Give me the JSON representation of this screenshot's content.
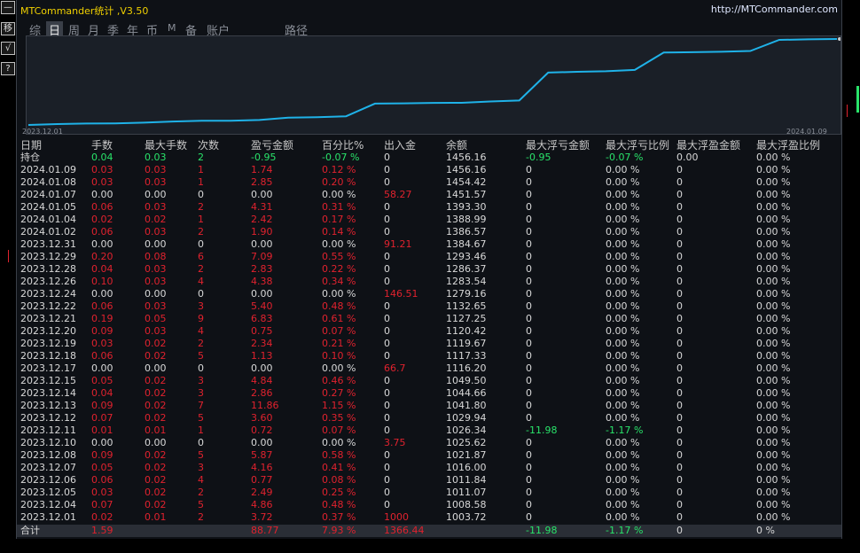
{
  "sidebar": {
    "buttons": [
      "—",
      "移",
      "√",
      "?"
    ]
  },
  "header": {
    "title": "MTCommander统计 ,V3.50",
    "url": "http://MTCommander.com"
  },
  "tabs": [
    "综",
    "日",
    "周",
    "月",
    "季",
    "年",
    "币",
    "M",
    "备",
    "账户",
    "路径"
  ],
  "active_tab": "日",
  "chart": {
    "start_date": "2023.12.01",
    "end_date": "2024.01.09",
    "line_color": "#1fb2e8",
    "balances": [
      1003.72,
      1008.58,
      1011.07,
      1011.84,
      1016.0,
      1021.87,
      1025.62,
      1026.34,
      1029.94,
      1041.8,
      1044.66,
      1049.5,
      1116.2,
      1117.33,
      1119.67,
      1120.42,
      1127.25,
      1132.65,
      1279.16,
      1283.54,
      1286.37,
      1293.46,
      1384.67,
      1386.57,
      1388.99,
      1393.3,
      1451.57,
      1454.42,
      1456.16
    ]
  },
  "table": {
    "headers": [
      "日期",
      "手数",
      "最大手数",
      "次数",
      "盈亏金额",
      "百分比%",
      "出入金",
      "余额",
      "最大浮亏金额",
      "最大浮亏比例",
      "最大浮盈金额",
      "最大浮盈比例"
    ],
    "holding": [
      "持仓",
      "0.04",
      "0.03",
      "2",
      "-0.95",
      "-0.07 %",
      "0",
      "1456.16",
      "-0.95",
      "-0.07 %",
      "0.00",
      "0.00 %"
    ],
    "rows": [
      [
        "2024.01.09",
        "0.03",
        "0.03",
        "1",
        "1.74",
        "0.12 %",
        "0",
        "1456.16",
        "0",
        "0.00 %",
        "0",
        "0.00 %"
      ],
      [
        "2024.01.08",
        "0.03",
        "0.03",
        "1",
        "2.85",
        "0.20 %",
        "0",
        "1454.42",
        "0",
        "0.00 %",
        "0",
        "0.00 %"
      ],
      [
        "2024.01.07",
        "0.00",
        "0.00",
        "0",
        "0.00",
        "0.00 %",
        "58.27",
        "1451.57",
        "0",
        "0.00 %",
        "0",
        "0.00 %"
      ],
      [
        "2024.01.05",
        "0.06",
        "0.03",
        "2",
        "4.31",
        "0.31 %",
        "0",
        "1393.30",
        "0",
        "0.00 %",
        "0",
        "0.00 %"
      ],
      [
        "2024.01.04",
        "0.02",
        "0.02",
        "1",
        "2.42",
        "0.17 %",
        "0",
        "1388.99",
        "0",
        "0.00 %",
        "0",
        "0.00 %"
      ],
      [
        "2024.01.02",
        "0.06",
        "0.03",
        "2",
        "1.90",
        "0.14 %",
        "0",
        "1386.57",
        "0",
        "0.00 %",
        "0",
        "0.00 %"
      ],
      [
        "2023.12.31",
        "0.00",
        "0.00",
        "0",
        "0.00",
        "0.00 %",
        "91.21",
        "1384.67",
        "0",
        "0.00 %",
        "0",
        "0.00 %"
      ],
      [
        "2023.12.29",
        "0.20",
        "0.08",
        "6",
        "7.09",
        "0.55 %",
        "0",
        "1293.46",
        "0",
        "0.00 %",
        "0",
        "0.00 %"
      ],
      [
        "2023.12.28",
        "0.04",
        "0.03",
        "2",
        "2.83",
        "0.22 %",
        "0",
        "1286.37",
        "0",
        "0.00 %",
        "0",
        "0.00 %"
      ],
      [
        "2023.12.26",
        "0.10",
        "0.03",
        "4",
        "4.38",
        "0.34 %",
        "0",
        "1283.54",
        "0",
        "0.00 %",
        "0",
        "0.00 %"
      ],
      [
        "2023.12.24",
        "0.00",
        "0.00",
        "0",
        "0.00",
        "0.00 %",
        "146.51",
        "1279.16",
        "0",
        "0.00 %",
        "0",
        "0.00 %"
      ],
      [
        "2023.12.22",
        "0.06",
        "0.03",
        "3",
        "5.40",
        "0.48 %",
        "0",
        "1132.65",
        "0",
        "0.00 %",
        "0",
        "0.00 %"
      ],
      [
        "2023.12.21",
        "0.19",
        "0.05",
        "9",
        "6.83",
        "0.61 %",
        "0",
        "1127.25",
        "0",
        "0.00 %",
        "0",
        "0.00 %"
      ],
      [
        "2023.12.20",
        "0.09",
        "0.03",
        "4",
        "0.75",
        "0.07 %",
        "0",
        "1120.42",
        "0",
        "0.00 %",
        "0",
        "0.00 %"
      ],
      [
        "2023.12.19",
        "0.03",
        "0.02",
        "2",
        "2.34",
        "0.21 %",
        "0",
        "1119.67",
        "0",
        "0.00 %",
        "0",
        "0.00 %"
      ],
      [
        "2023.12.18",
        "0.06",
        "0.02",
        "5",
        "1.13",
        "0.10 %",
        "0",
        "1117.33",
        "0",
        "0.00 %",
        "0",
        "0.00 %"
      ],
      [
        "2023.12.17",
        "0.00",
        "0.00",
        "0",
        "0.00",
        "0.00 %",
        "66.7",
        "1116.20",
        "0",
        "0.00 %",
        "0",
        "0.00 %"
      ],
      [
        "2023.12.15",
        "0.05",
        "0.02",
        "3",
        "4.84",
        "0.46 %",
        "0",
        "1049.50",
        "0",
        "0.00 %",
        "0",
        "0.00 %"
      ],
      [
        "2023.12.14",
        "0.04",
        "0.02",
        "3",
        "2.86",
        "0.27 %",
        "0",
        "1044.66",
        "0",
        "0.00 %",
        "0",
        "0.00 %"
      ],
      [
        "2023.12.13",
        "0.09",
        "0.02",
        "7",
        "11.86",
        "1.15 %",
        "0",
        "1041.80",
        "0",
        "0.00 %",
        "0",
        "0.00 %"
      ],
      [
        "2023.12.12",
        "0.07",
        "0.02",
        "5",
        "3.60",
        "0.35 %",
        "0",
        "1029.94",
        "0",
        "0.00 %",
        "0",
        "0.00 %"
      ],
      [
        "2023.12.11",
        "0.01",
        "0.01",
        "1",
        "0.72",
        "0.07 %",
        "0",
        "1026.34",
        "-11.98",
        "-1.17 %",
        "0",
        "0.00 %"
      ],
      [
        "2023.12.10",
        "0.00",
        "0.00",
        "0",
        "0.00",
        "0.00 %",
        "3.75",
        "1025.62",
        "0",
        "0.00 %",
        "0",
        "0.00 %"
      ],
      [
        "2023.12.08",
        "0.09",
        "0.02",
        "5",
        "5.87",
        "0.58 %",
        "0",
        "1021.87",
        "0",
        "0.00 %",
        "0",
        "0.00 %"
      ],
      [
        "2023.12.07",
        "0.05",
        "0.02",
        "3",
        "4.16",
        "0.41 %",
        "0",
        "1016.00",
        "0",
        "0.00 %",
        "0",
        "0.00 %"
      ],
      [
        "2023.12.06",
        "0.06",
        "0.02",
        "4",
        "0.77",
        "0.08 %",
        "0",
        "1011.84",
        "0",
        "0.00 %",
        "0",
        "0.00 %"
      ],
      [
        "2023.12.05",
        "0.03",
        "0.02",
        "2",
        "2.49",
        "0.25 %",
        "0",
        "1011.07",
        "0",
        "0.00 %",
        "0",
        "0.00 %"
      ],
      [
        "2023.12.04",
        "0.07",
        "0.02",
        "5",
        "4.86",
        "0.48 %",
        "0",
        "1008.58",
        "0",
        "0.00 %",
        "0",
        "0.00 %"
      ],
      [
        "2023.12.01",
        "0.02",
        "0.01",
        "2",
        "3.72",
        "0.37 %",
        "1000",
        "1003.72",
        "0",
        "0.00 %",
        "0",
        "0.00 %"
      ]
    ],
    "total": [
      "合计",
      "1.59",
      "",
      "",
      "88.77",
      "7.93 %",
      "1366.44",
      "",
      "-11.98",
      "-1.17 %",
      "0",
      "0 %"
    ]
  }
}
